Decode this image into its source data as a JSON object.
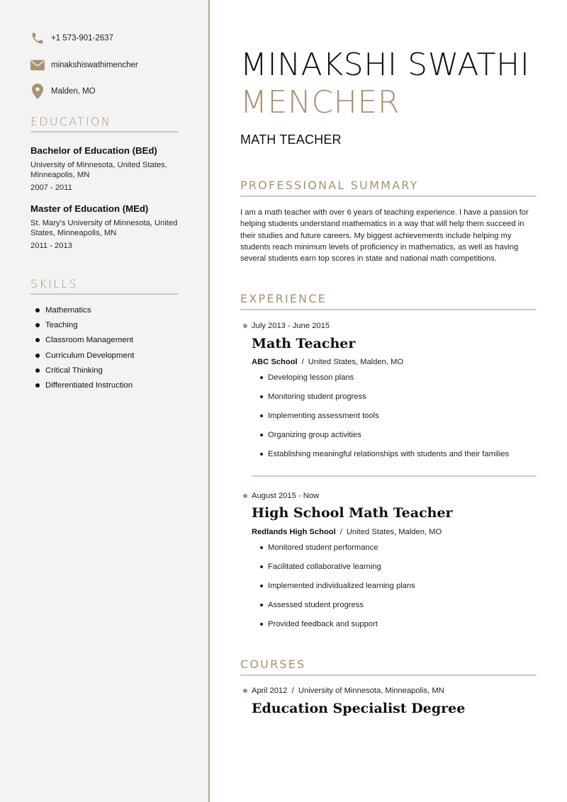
{
  "colors": {
    "accent": "#a8926f",
    "sidebar_bg": "#f3f3f3",
    "divider": "#b7a48e"
  },
  "contact": {
    "phone": {
      "icon": "phone-icon",
      "value": "+1 573-901-2637"
    },
    "email": {
      "icon": "envelope-icon",
      "value": "minakshiswathimencher"
    },
    "location": {
      "icon": "map-pin-icon",
      "value": "Malden, MO"
    }
  },
  "education": {
    "heading": "EDUCATION",
    "items": [
      {
        "degree": "Bachelor of Education (BEd)",
        "school": "University of Minnesota, United States, Minneapolis, MN",
        "dates": "2007 - 2011"
      },
      {
        "degree": "Master of Education (MEd)",
        "school": "St. Mary's University of Minnesota, United States, Minneapolis, MN",
        "dates": "2011 - 2013"
      }
    ]
  },
  "skills": {
    "heading": "SKILLS",
    "items": [
      "Mathematics",
      "Teaching",
      "Classroom Management",
      "Curriculum Development",
      "Critical Thinking",
      "Differentiated Instruction"
    ]
  },
  "header": {
    "first_names": "MINAKSHI SWATHI",
    "last_name": "MENCHER",
    "job_title": "MATH TEACHER"
  },
  "summary": {
    "heading": "PROFESSIONAL SUMMARY",
    "text": "I am a math teacher with over 6 years of teaching experience. I have a passion for helping students understand mathematics in a way that will help them succeed in their studies and future careers. My biggest achievements include helping my students reach minimum levels of proficiency in mathematics, as well as having several students earn top scores in state and national math competitions."
  },
  "experience": {
    "heading": "EXPERIENCE",
    "items": [
      {
        "dates": "July 2013 - June 2015",
        "role": "Math Teacher",
        "company": "ABC School",
        "separator": "/",
        "location": "United States, Malden, MO",
        "bullets": [
          "Developing lesson plans",
          "Monitoring student progress",
          "Implementing assessment tools",
          "Organizing group activities",
          "Establishing meaningful relationships with students and their families"
        ]
      },
      {
        "dates": "August 2015 - Now",
        "role": "High School Math Teacher",
        "company": "Redlands High School",
        "separator": "/",
        "location": "United States, Malden, MO",
        "bullets": [
          "Monitored student performance",
          "Facilitated collaborative learning",
          "Implemented individualized learning plans",
          "Assessed student progress",
          "Provided feedback and support"
        ]
      }
    ]
  },
  "courses": {
    "heading": "COURSES",
    "items": [
      {
        "date_line": "April 2012  /  University of Minnesota, Minneapolis, MN",
        "title": "Education Specialist Degree"
      }
    ]
  }
}
